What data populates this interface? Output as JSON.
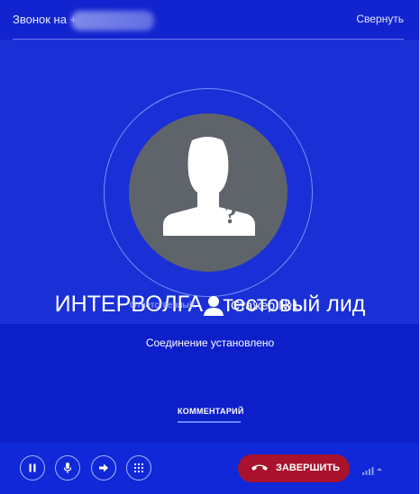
{
  "header": {
    "title": "Звонок на +",
    "collapse_label": "Свернуть"
  },
  "contact": {
    "name": "ИНТЕРВОЛГА - тестовый лид"
  },
  "responsible": {
    "label": "Ответственный:",
    "name": "Стажер №1"
  },
  "status": "Соединение установлено",
  "tabs": [
    {
      "label": "КОММЕНТАРИЙ"
    }
  ],
  "footer": {
    "controls": [
      {
        "name": "pause-icon"
      },
      {
        "name": "microphone-icon"
      },
      {
        "name": "transfer-arrow-icon"
      },
      {
        "name": "keypad-icon"
      }
    ],
    "end_call_label": "ЗАВЕРШИТЬ"
  },
  "colors": {
    "background": "#1a30d6",
    "end_call": "#a8122c"
  }
}
